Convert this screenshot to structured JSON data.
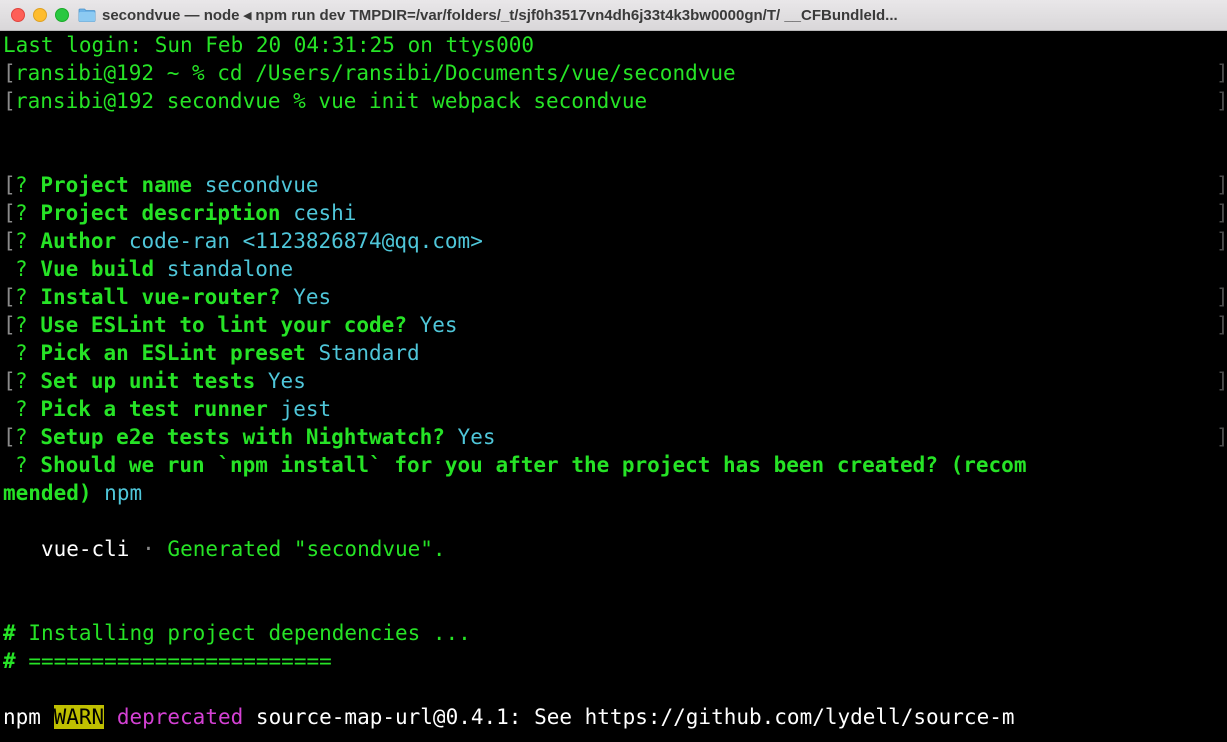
{
  "window": {
    "title": "secondvue — node ◂ npm run dev TMPDIR=/var/folders/_t/sjf0h3517vn4dh6j33t4k3bw0000gn/T/ __CFBundleId..."
  },
  "terminal": {
    "last_login": "Last login: Sun Feb 20 04:31:25 on ttys000",
    "cmd1": "ransibi@192 ~ % cd /Users/ransibi/Documents/vue/secondvue",
    "cmd2": "ransibi@192 secondvue % vue init webpack secondvue",
    "q_mark": "?",
    "questions": [
      {
        "label": "Project name",
        "answer": "secondvue"
      },
      {
        "label": "Project description",
        "answer": "ceshi"
      },
      {
        "label": "Author",
        "answer": "code-ran <1123826874@qq.com>"
      },
      {
        "label": "Vue build",
        "answer": "standalone"
      },
      {
        "label": "Install vue-router?",
        "answer": "Yes"
      },
      {
        "label": "Use ESLint to lint your code?",
        "answer": "Yes"
      },
      {
        "label": "Pick an ESLint preset",
        "answer": "Standard"
      },
      {
        "label": "Set up unit tests",
        "answer": "Yes"
      },
      {
        "label": "Pick a test runner",
        "answer": "jest"
      },
      {
        "label": "Setup e2e tests with Nightwatch?",
        "answer": "Yes"
      },
      {
        "label": "Should we run `npm install` for you after the project has been created? (recom",
        "answer": ""
      }
    ],
    "wrap_label": "mended)",
    "wrap_answer": "npm",
    "vue_cli": "vue-cli",
    "vue_cli_sep": "·",
    "generated": "Generated \"secondvue\".",
    "hash": "#",
    "installing": "Installing project dependencies ...",
    "separator": "========================",
    "npm": "npm",
    "warn": "WARN",
    "deprecated": "deprecated",
    "warn_msg": "source-map-url@0.4.1: See https://github.com/lydell/source-m"
  }
}
